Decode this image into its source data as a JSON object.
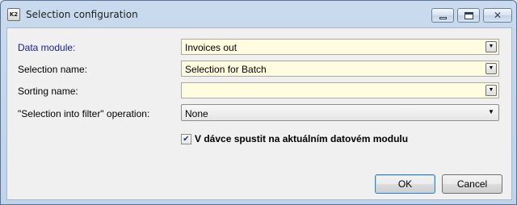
{
  "window": {
    "title": "Selection configuration",
    "app_icon_text": "K2"
  },
  "form": {
    "data_module": {
      "label": "Data module:",
      "value": "Invoices out"
    },
    "selection_name": {
      "label": "Selection name:",
      "value": "Selection for Batch"
    },
    "sorting_name": {
      "label": "Sorting name:",
      "value": ""
    },
    "selection_filter_operation": {
      "label": "\"Selection into filter\" operation:",
      "value": "None"
    },
    "batch_checkbox": {
      "label": "V dávce spustit na aktuálním datovém modulu",
      "checked": true,
      "check_glyph": "✔"
    }
  },
  "buttons": {
    "ok": "OK",
    "cancel": "Cancel"
  },
  "glyphs": {
    "dropdown": "▼",
    "close": "✕"
  }
}
